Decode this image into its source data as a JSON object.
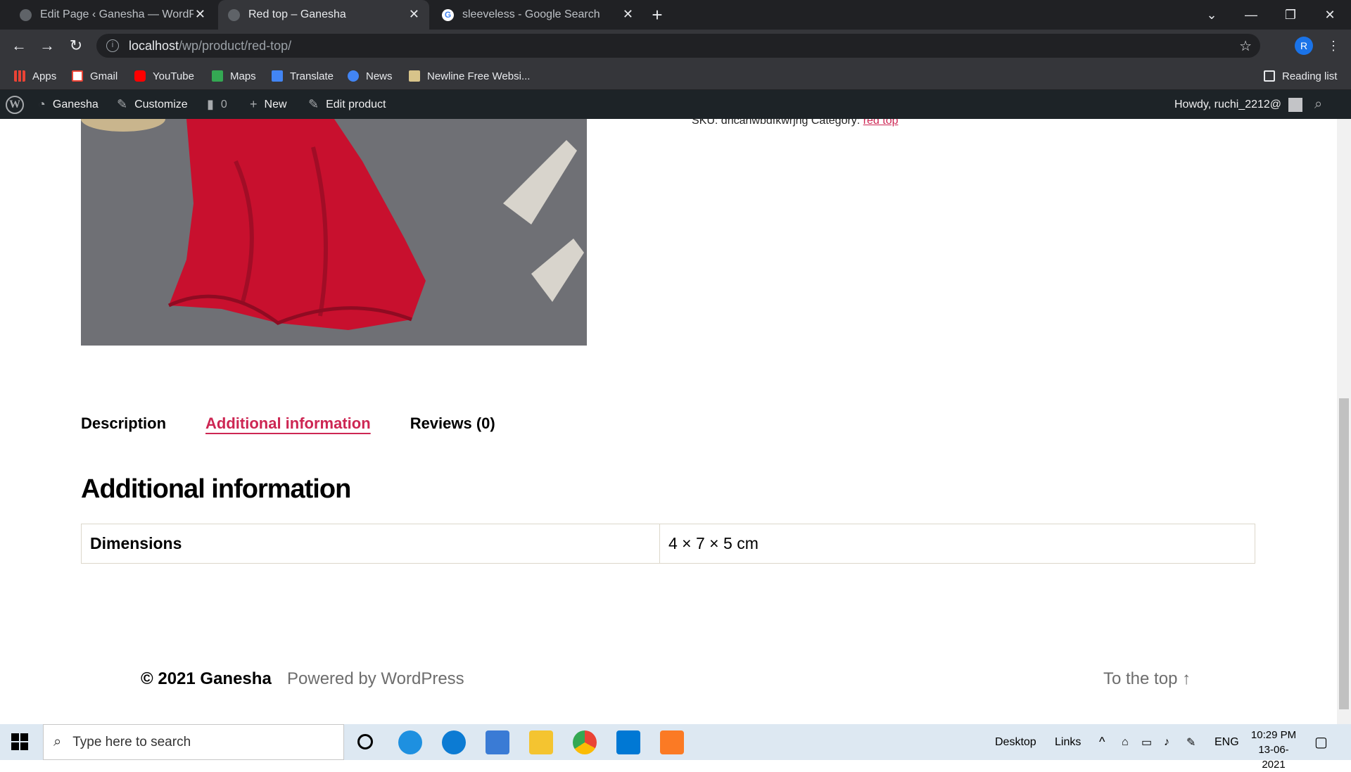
{
  "browser": {
    "tabs": [
      {
        "title": "Edit Page ‹ Ganesha — WordPress",
        "close": "✕"
      },
      {
        "title": "Red top – Ganesha",
        "close": "✕"
      },
      {
        "title": "sleeveless - Google Search",
        "close": "✕"
      }
    ],
    "new_tab": "+",
    "url_host": "localhost",
    "url_path": "/wp/product/red-top/",
    "profile_initial": "R",
    "bookmarks": [
      "Apps",
      "Gmail",
      "YouTube",
      "Maps",
      "Translate",
      "News",
      "Newline Free Websi..."
    ],
    "reading_list": "Reading list"
  },
  "wpbar": {
    "site": "Ganesha",
    "customize": "Customize",
    "comments": "0",
    "new": "New",
    "edit": "Edit product",
    "howdy": "Howdy, ruchi_2212@"
  },
  "product": {
    "sku_label": "SKU:",
    "sku_value": "dncahwbdfkwrjng",
    "category_label": "Category:",
    "category": "red top",
    "tabs": [
      "Description",
      "Additional information",
      "Reviews (0)"
    ],
    "heading": "Additional information",
    "attributes": [
      {
        "name": "Dimensions",
        "value": "4 × 7 × 5 cm"
      }
    ]
  },
  "footer": {
    "copyright": "© 2021 Ganesha",
    "powered": "Powered by WordPress",
    "to_top": "To the top ↑"
  },
  "taskbar": {
    "search_placeholder": "Type here to search",
    "desktop": "Desktop",
    "links": "Links",
    "lang": "ENG",
    "time": "10:29 PM",
    "date": "13-06-2021"
  },
  "colors": {
    "accent": "#cd2653",
    "wp_bar": "#1d2327",
    "chrome_dark": "#202124"
  }
}
